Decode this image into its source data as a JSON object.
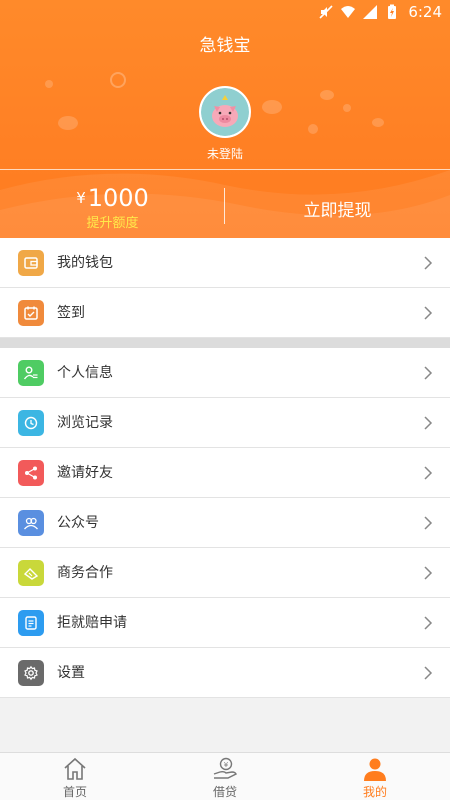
{
  "status_bar": {
    "time": "6:24"
  },
  "app": {
    "title": "急钱宝"
  },
  "profile": {
    "login_label": "未登陆"
  },
  "quota": {
    "currency": "¥",
    "amount": "1000",
    "raise_label": "提升额度",
    "withdraw_label": "立即提现"
  },
  "menu_group_1": [
    {
      "label": "我的钱包",
      "icon": "wallet-icon",
      "color": "#f0a847"
    },
    {
      "label": "签到",
      "icon": "calendar-checkin-icon",
      "color": "#f08a3c"
    }
  ],
  "menu_group_2": [
    {
      "label": "个人信息",
      "icon": "user-info-icon",
      "color": "#4fcc63"
    },
    {
      "label": "浏览记录",
      "icon": "history-icon",
      "color": "#3cb6e3"
    },
    {
      "label": "邀请好友",
      "icon": "share-icon",
      "color": "#f25a5a"
    },
    {
      "label": "公众号",
      "icon": "users-icon",
      "color": "#5a8fe0"
    },
    {
      "label": "商务合作",
      "icon": "cooperation-icon",
      "color": "#c9d83a"
    },
    {
      "label": "拒就赔申请",
      "icon": "document-icon",
      "color": "#2d9cf0"
    },
    {
      "label": "设置",
      "icon": "gear-icon",
      "color": "#6a6a6a"
    }
  ],
  "bottom_nav": [
    {
      "label": "首页",
      "icon": "home-icon",
      "active": false
    },
    {
      "label": "借贷",
      "icon": "loan-icon",
      "active": false
    },
    {
      "label": "我的",
      "icon": "person-icon",
      "active": true
    }
  ],
  "colors": {
    "brand": "#ff8125",
    "accent_yellow": "#ffe94a",
    "active_tab": "#ff7d1e"
  }
}
